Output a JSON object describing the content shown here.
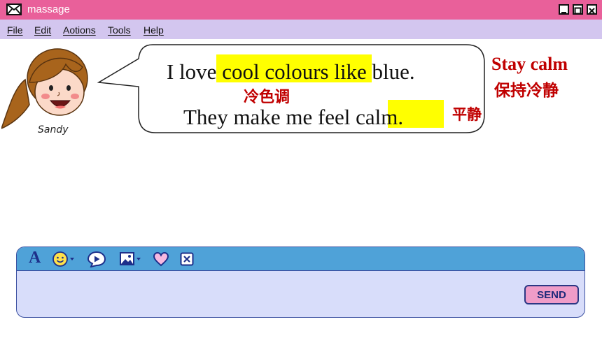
{
  "window": {
    "title": "massage",
    "controls": [
      "minimize",
      "maximize",
      "close"
    ]
  },
  "menu": {
    "items": [
      {
        "label": "File"
      },
      {
        "label": "Edit"
      },
      {
        "label": "Aotions"
      },
      {
        "label": "Tools"
      },
      {
        "label": "Help"
      }
    ]
  },
  "avatar": {
    "name": "Sandy"
  },
  "bubble": {
    "line1": "I love cool colours like blue.",
    "line2": "They make me feel calm.",
    "note_cool": "冷色调",
    "note_calm": "平静"
  },
  "side_note": {
    "english": "Stay calm",
    "chinese": "保持冷静"
  },
  "composer": {
    "toolbar_icons": [
      "font-icon",
      "emoji-icon",
      "sticker-icon",
      "image-icon",
      "heart-icon",
      "clear-icon"
    ],
    "send_label": "SEND"
  },
  "colors": {
    "titlebar": "#e9609a",
    "menubar": "#d3c6ef",
    "highlight": "#ffff00",
    "annotation": "#c00000",
    "toolbar": "#4fa2d8",
    "composer_bg": "#d8ddfa",
    "send_button": "#ef9cc8"
  }
}
